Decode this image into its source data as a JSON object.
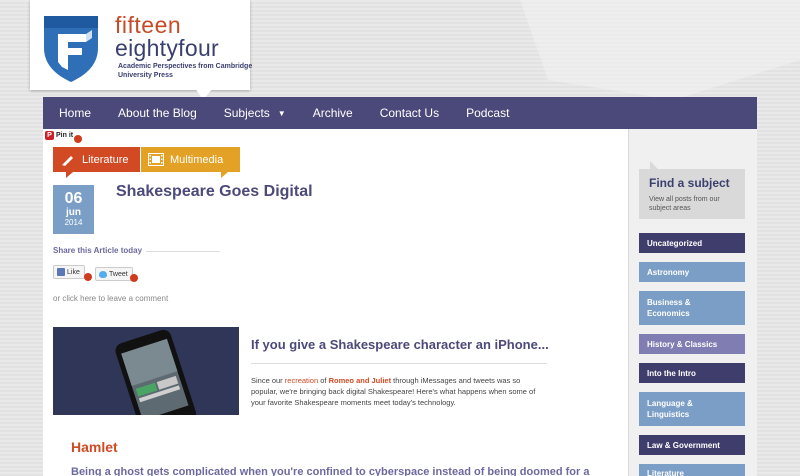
{
  "brand": {
    "line1": "fifteen",
    "line2": "eightyfour",
    "tagline": "Academic Perspectives from Cambridge University Press",
    "colors": {
      "orange": "#c84a26",
      "navy": "#3a3f6e",
      "shield_blue": "#2e6fb7"
    }
  },
  "nav": {
    "items": [
      {
        "label": "Home"
      },
      {
        "label": "About the Blog"
      },
      {
        "label": "Subjects",
        "has_dropdown": true
      },
      {
        "label": "Archive"
      },
      {
        "label": "Contact Us"
      },
      {
        "label": "Podcast"
      }
    ]
  },
  "pin": {
    "label": "Pin it"
  },
  "categories": [
    {
      "label": "Literature",
      "icon": "pen-icon",
      "color": "#d14a23"
    },
    {
      "label": "Multimedia",
      "icon": "film-icon",
      "color": "#e3a125"
    }
  ],
  "date": {
    "day": "06",
    "month": "jun",
    "year": "2014"
  },
  "post": {
    "title": "Shakespeare Goes Digital",
    "share_label": "Share this Article today",
    "like_label": "Like",
    "tweet_label": "Tweet",
    "comment_link": "or click here to leave a comment"
  },
  "feature": {
    "title": "If you give a Shakespeare character an iPhone...",
    "text_before": "Since our ",
    "link1": "recreation",
    "text_mid": " of ",
    "link2": "Romeo and Juliet",
    "text_after": " through iMessages and tweets was so popular, we're bringing back digital Shakespeare! Here's what happens when some of your favorite Shakespeare moments meet today's technology."
  },
  "section": {
    "heading": "Hamlet",
    "text": "Being a ghost gets complicated when you're confined to cyberspace instead of being doomed for a"
  },
  "sidebar": {
    "find_title": "Find a subject",
    "find_sub": "View all posts from our subject areas",
    "items": [
      {
        "label": "Uncategorized"
      },
      {
        "label": "Astronomy"
      },
      {
        "label": "Business & Economics"
      },
      {
        "label": "History & Classics"
      },
      {
        "label": "Into the Intro"
      },
      {
        "label": "Language & Linguistics"
      },
      {
        "label": "Law & Government"
      },
      {
        "label": "Literature"
      }
    ]
  }
}
